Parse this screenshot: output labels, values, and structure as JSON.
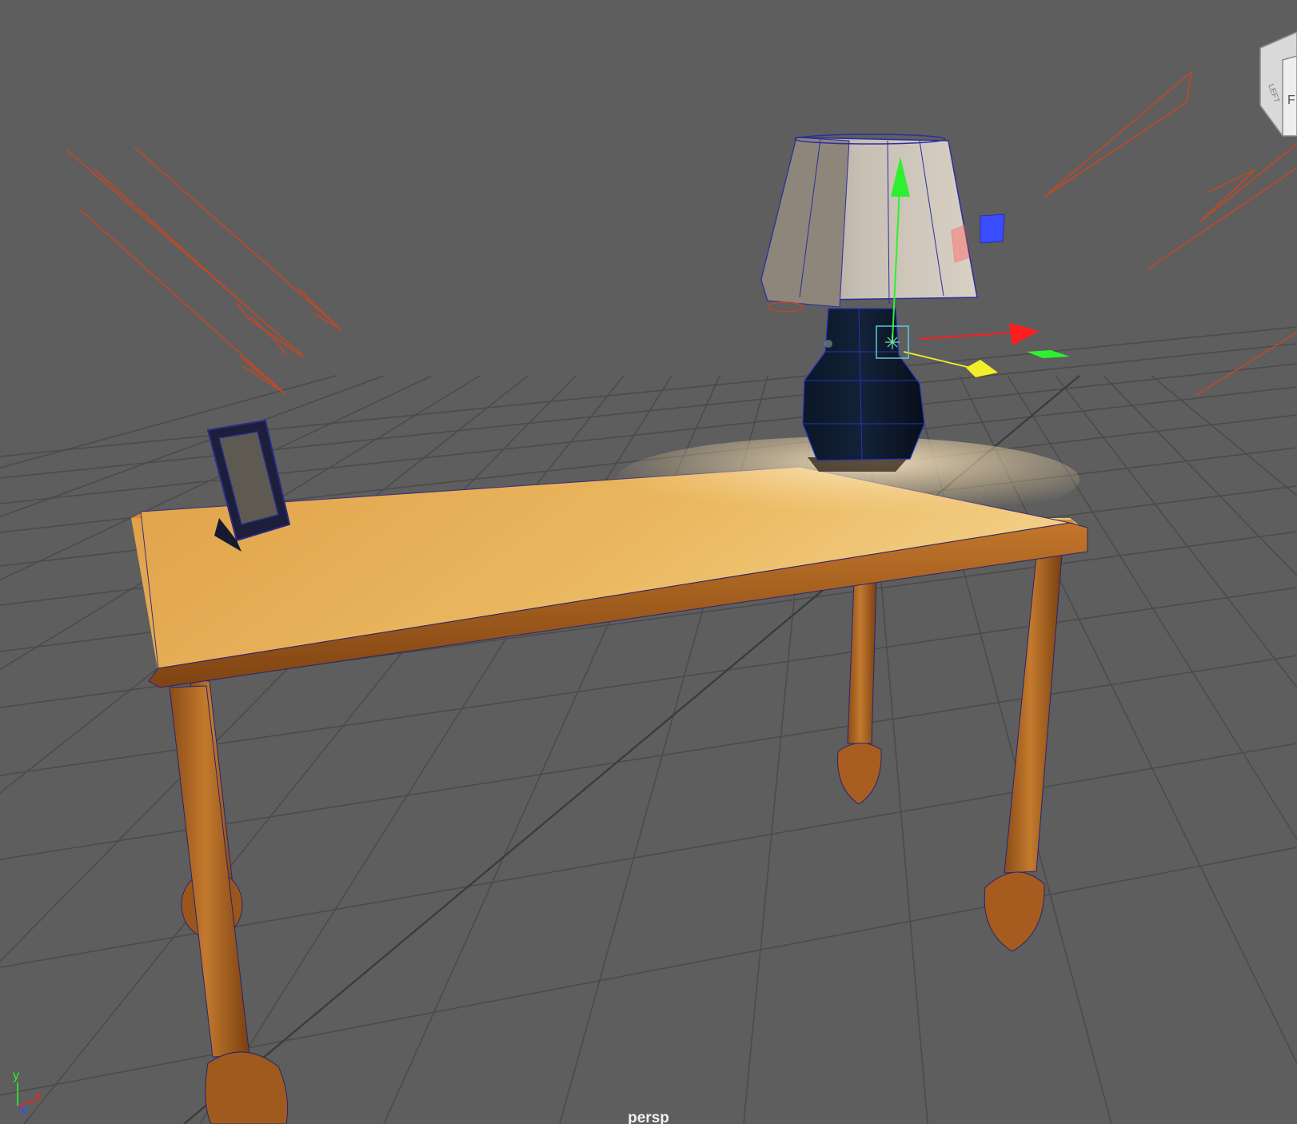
{
  "viewport": {
    "camera_label": "persp",
    "view_cube_faces": [
      "LEFT",
      "F"
    ],
    "axis_triad": {
      "x": "x",
      "y": "y",
      "z": "z"
    },
    "colors": {
      "background": "#5e5e5e",
      "grid": "#4a4a4a",
      "grid_axis": "#3f3f3f",
      "light_helper": "#b84a2c",
      "wireframe": "#1a1a8a",
      "manip_x": "#ff1e1e",
      "manip_y": "#2ef02e",
      "manip_z": "#3a4dff",
      "pivot": "#5ec8e0",
      "light_aim": "#f2ef2a"
    },
    "scene_objects": [
      "table",
      "picture-frame",
      "table-lamp"
    ]
  }
}
